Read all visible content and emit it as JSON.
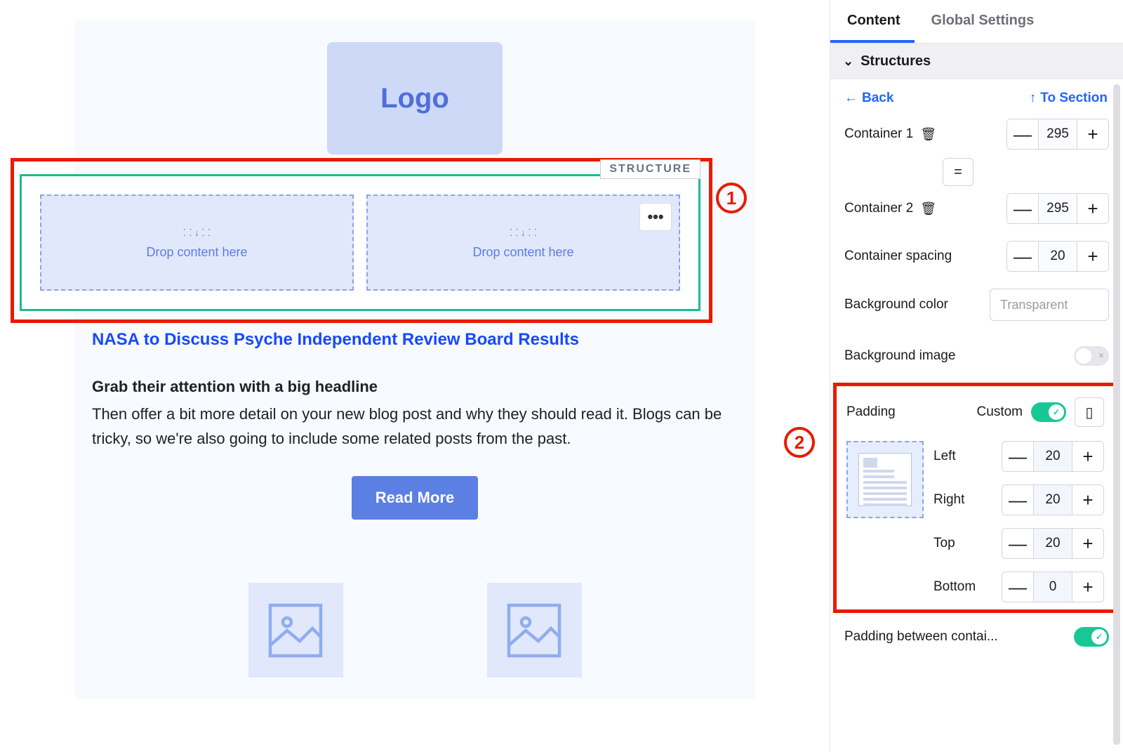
{
  "tabs": {
    "content": "Content",
    "global": "Global Settings"
  },
  "section_title": "Structures",
  "nav": {
    "back": "Back",
    "to_section": "To Section"
  },
  "containers": {
    "c1_label": "Container 1",
    "c1_val": "295",
    "c2_label": "Container 2",
    "c2_val": "295",
    "spacing_label": "Container spacing",
    "spacing_val": "20",
    "equal": "="
  },
  "bg": {
    "color_label": "Background color",
    "color_placeholder": "Transparent",
    "image_label": "Background image"
  },
  "padding": {
    "title": "Padding",
    "custom": "Custom",
    "left_label": "Left",
    "left_val": "20",
    "right_label": "Right",
    "right_val": "20",
    "top_label": "Top",
    "top_val": "20",
    "bottom_label": "Bottom",
    "bottom_val": "0"
  },
  "pad_between": "Padding between contai...",
  "canvas": {
    "logo": "Logo",
    "structure_tag": "STRUCTURE",
    "drop": "Drop content here",
    "headline_link": "NASA to Discuss Psyche Independent Review Board Results",
    "subhead": "Grab their attention with a big headline",
    "body": "Then offer a bit more detail on your new blog post and why they should read it. Blogs can be tricky, so we're also going to include some related posts from the past.",
    "read_more": "Read More"
  },
  "callouts": {
    "one": "1",
    "two": "2"
  }
}
